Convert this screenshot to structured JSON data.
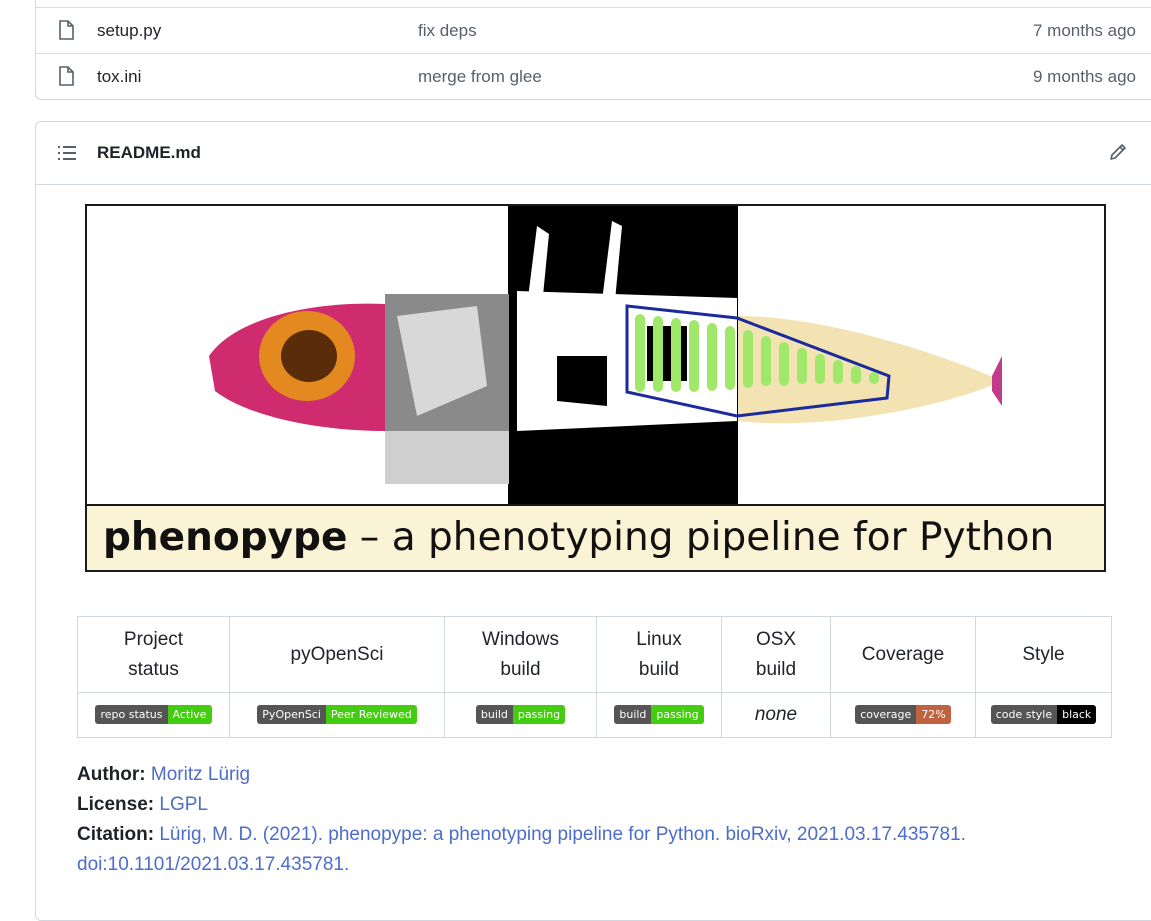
{
  "files": [
    {
      "name": "setup.py",
      "message": "fix deps",
      "age": "7 months ago"
    },
    {
      "name": "tox.ini",
      "message": "merge from glee",
      "age": "9 months ago"
    }
  ],
  "readme": {
    "title": "README.md",
    "banner": {
      "bold_text": "phenopype",
      "rest_text": " – a phenotyping pipeline for Python"
    },
    "badge_table": {
      "headers": [
        [
          "Project",
          "status"
        ],
        [
          "pyOpenSci"
        ],
        [
          "Windows",
          "build"
        ],
        [
          "Linux",
          "build"
        ],
        [
          "OSX",
          "build"
        ],
        [
          "Coverage"
        ],
        [
          "Style"
        ]
      ],
      "badges": [
        {
          "left": "repo status",
          "right": "Active",
          "color": "#4c1"
        },
        {
          "left": "PyOpenSci",
          "right": "Peer Reviewed",
          "color": "#4c1"
        },
        {
          "left": "build",
          "right": "passing",
          "color": "#4c1"
        },
        {
          "left": "build",
          "right": "passing",
          "color": "#4c1"
        },
        {
          "none": "none"
        },
        {
          "left": "coverage",
          "right": "72%",
          "color": "#c0623f"
        },
        {
          "left": "code style",
          "right": "black",
          "color": "#000000"
        }
      ]
    },
    "author_label": "Author:",
    "author": "Moritz Lürig",
    "license_label": "License:",
    "license": "LGPL",
    "citation_label": "Citation:",
    "citation_line1": "Lürig, M. D. (2021). phenopype: a phenotyping pipeline for Python. bioRxiv, 2021.03.17.435781.",
    "citation_line2": "doi:10.1101/2021.03.17.435781."
  },
  "colors": {
    "link": "#4c6dc9",
    "badge_green": "#4c1",
    "border": "#d0d7de"
  }
}
